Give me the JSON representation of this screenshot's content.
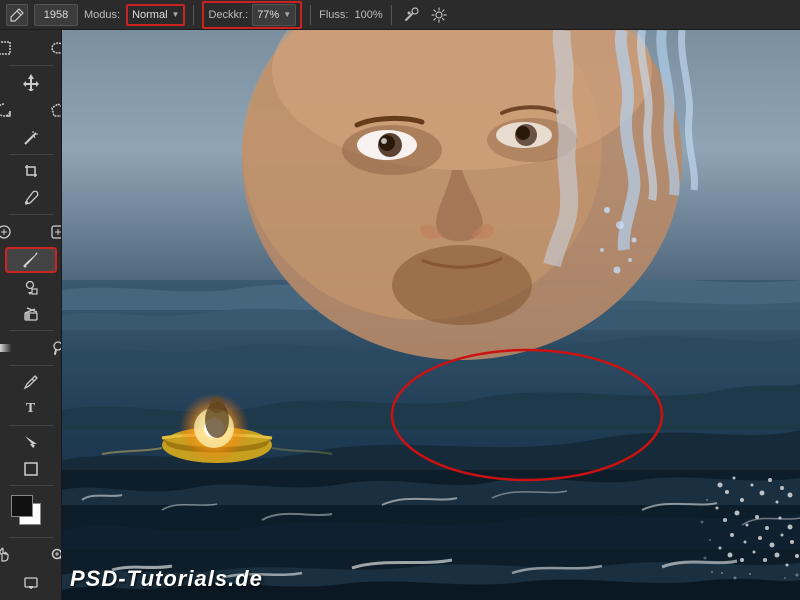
{
  "toolbar": {
    "brush_icon": "⬤",
    "brush_size": "1958",
    "modus_label": "Modus:",
    "modus_value": "Normal",
    "deckkr_label": "Deckkr.:",
    "deckkr_value": "77%",
    "fluss_label": "Fluss:",
    "fluss_value": "100%"
  },
  "tools": [
    {
      "name": "marquee-rect",
      "icon": "▭",
      "active": false
    },
    {
      "name": "marquee-ellipse",
      "icon": "◯",
      "active": false
    },
    {
      "name": "move",
      "icon": "✥",
      "active": false
    },
    {
      "name": "lasso",
      "icon": "⌒",
      "active": false
    },
    {
      "name": "magic-wand",
      "icon": "✦",
      "active": false
    },
    {
      "name": "crop",
      "icon": "⌗",
      "active": false
    },
    {
      "name": "eyedropper",
      "icon": "🔍",
      "active": false
    },
    {
      "name": "heal",
      "icon": "⊕",
      "active": false
    },
    {
      "name": "brush",
      "icon": "✏",
      "active": true
    },
    {
      "name": "stamp",
      "icon": "⬡",
      "active": false
    },
    {
      "name": "eraser",
      "icon": "◻",
      "active": false
    },
    {
      "name": "gradient",
      "icon": "▦",
      "active": false
    },
    {
      "name": "dodge",
      "icon": "◑",
      "active": false
    },
    {
      "name": "pen",
      "icon": "✒",
      "active": false
    },
    {
      "name": "text",
      "icon": "T",
      "active": false
    },
    {
      "name": "path-select",
      "icon": "↖",
      "active": false
    },
    {
      "name": "shape",
      "icon": "■",
      "active": false
    },
    {
      "name": "hand",
      "icon": "✋",
      "active": false
    },
    {
      "name": "zoom",
      "icon": "🔎",
      "active": false
    }
  ],
  "bottom_text": "PSD-Tutorials.de",
  "canvas": {
    "ellipse_label": "red oval selection area",
    "brush_dot_label": "brush cursor preview"
  }
}
